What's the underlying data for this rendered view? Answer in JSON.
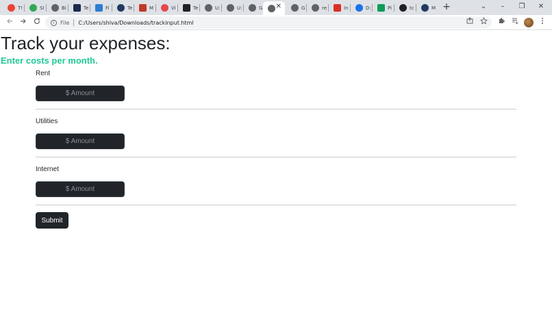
{
  "browser": {
    "tabs": [
      {
        "label": "T!",
        "color": "#ea4335"
      },
      {
        "label": "SI",
        "color": "#34a853"
      },
      {
        "label": "Bi",
        "color": "#5f6368"
      },
      {
        "label": "Te",
        "color": "#1a2b4c"
      },
      {
        "label": "Fi",
        "color": "#2f7bd0"
      },
      {
        "label": "Te",
        "color": "#1f3a5f"
      },
      {
        "label": "M",
        "color": "#c0392b"
      },
      {
        "label": "Vi",
        "color": "#e5484d"
      },
      {
        "label": "Te",
        "color": "#202124"
      },
      {
        "label": "U:",
        "color": "#5f6368"
      },
      {
        "label": "U:",
        "color": "#5f6368"
      },
      {
        "label": "G",
        "color": "#5f6368"
      },
      {
        "label": "",
        "color": "#5f6368"
      },
      {
        "label": "G",
        "color": "#5f6368"
      },
      {
        "label": "re",
        "color": "#5f6368"
      },
      {
        "label": "In",
        "color": "#d93025"
      },
      {
        "label": "D:",
        "color": "#1a73e8"
      },
      {
        "label": "Pi",
        "color": "#0f9d58"
      },
      {
        "label": "tc",
        "color": "#202124"
      },
      {
        "label": "M",
        "color": "#1f3a5f"
      }
    ],
    "new_tab": "+",
    "tab_search": "⌄",
    "minimize": "–",
    "restore": "❐",
    "close": "✕",
    "address": {
      "scheme_label": "File",
      "url": "C:/Users/shiva/Downloads/trackinput.html"
    }
  },
  "page": {
    "title": "Track your expenses:",
    "subtitle": "Enter costs per month.",
    "fields": [
      {
        "label": "Rent",
        "placeholder": "$ Amount"
      },
      {
        "label": "Utilities",
        "placeholder": "$ Amount"
      },
      {
        "label": "Internet",
        "placeholder": "$ Amount"
      }
    ],
    "submit_label": "Submit"
  }
}
